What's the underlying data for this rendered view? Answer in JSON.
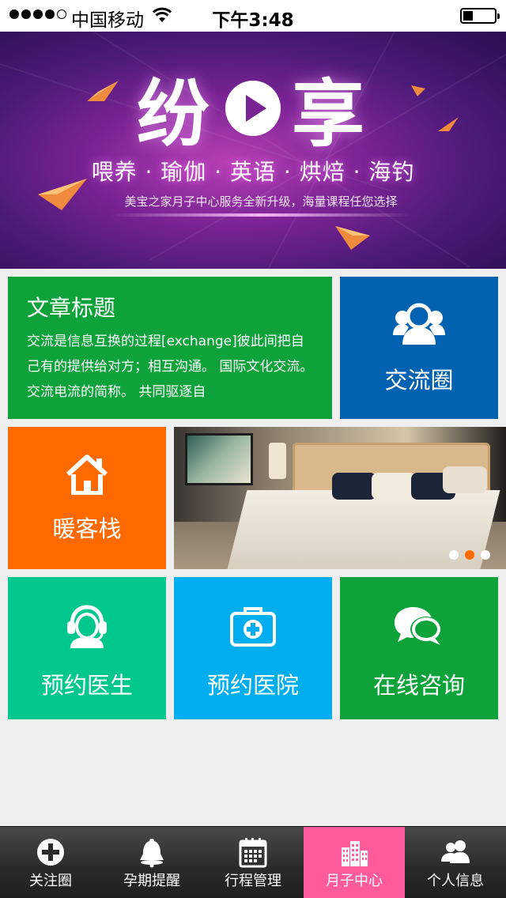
{
  "status_bar": {
    "carrier": "中国移动",
    "time": "下午3:48"
  },
  "banner": {
    "logo_left": "纷",
    "logo_right": "享",
    "subtitle": "喂养 · 瑜伽 · 英语 · 烘焙 · 海钓",
    "tagline": "美宝之家月子中心服务全新升级，海量课程任您选择"
  },
  "article": {
    "title": "文章标题",
    "body": "交流是信息互换的过程[exchange]彼此间把自己有的提供给对方；相互沟通。 国际文化交流。 交流电流的简称。 共同驱逐自"
  },
  "tiles": {
    "exchange": {
      "label": "交流圈",
      "icon": "people-circle-icon"
    },
    "hotel": {
      "label": "暖客栈",
      "icon": "house-icon"
    },
    "doctor": {
      "label": "预约医生",
      "icon": "headset-doctor-icon"
    },
    "hospital": {
      "label": "预约医院",
      "icon": "medical-kit-icon"
    },
    "consult": {
      "label": "在线咨询",
      "icon": "chat-bubbles-icon"
    }
  },
  "carousel": {
    "slide_count": 3,
    "active_index": 1
  },
  "tabbar": {
    "items": [
      {
        "label": "关注圈",
        "icon": "plus-circle-icon"
      },
      {
        "label": "孕期提醒",
        "icon": "bell-icon"
      },
      {
        "label": "行程管理",
        "icon": "calendar-icon"
      },
      {
        "label": "月子中心",
        "icon": "buildings-icon"
      },
      {
        "label": "个人信息",
        "icon": "users-icon"
      }
    ],
    "active_index": 3
  },
  "colors": {
    "green": "#0da33a",
    "blue": "#0062b0",
    "orange": "#ff6a00",
    "teal": "#00c78e",
    "sky": "#00aef0",
    "active_tab": "#ff5a9a"
  }
}
